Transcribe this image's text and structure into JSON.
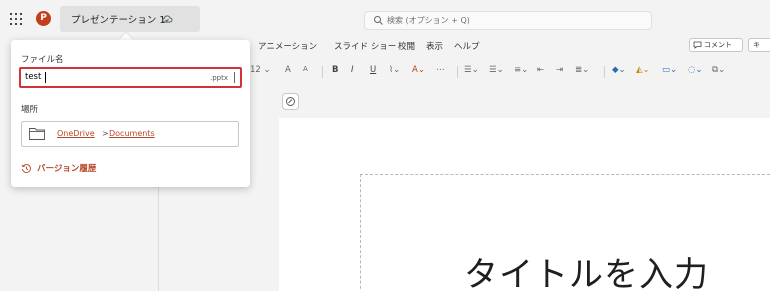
{
  "titlebar": {
    "app_logo_letter": "P",
    "document_title": "プレゼンテーション 1",
    "search_placeholder": "検索 (オプション + Q)"
  },
  "ribbon": {
    "menus": [
      "アニメーション",
      "スライド ショー",
      "校閲",
      "表示",
      "ヘルプ"
    ],
    "comment_label": "コメント",
    "share_label": "キ",
    "font_size": "12",
    "tools": [
      "A",
      "A",
      "B",
      "I",
      "U",
      "⋯"
    ]
  },
  "popup": {
    "filename_label": "ファイル名",
    "filename_value": "test",
    "extension": ".pptx",
    "location_label": "場所",
    "location_parts": [
      "OneDrive",
      "Documents"
    ],
    "location_separator": ">",
    "history_label": "バージョン履歴"
  },
  "slide": {
    "title_placeholder": "タイトルを入力"
  },
  "colors": {
    "accent": "#b7472a",
    "error_border": "#d13438",
    "app_red": "#c43e1c"
  }
}
